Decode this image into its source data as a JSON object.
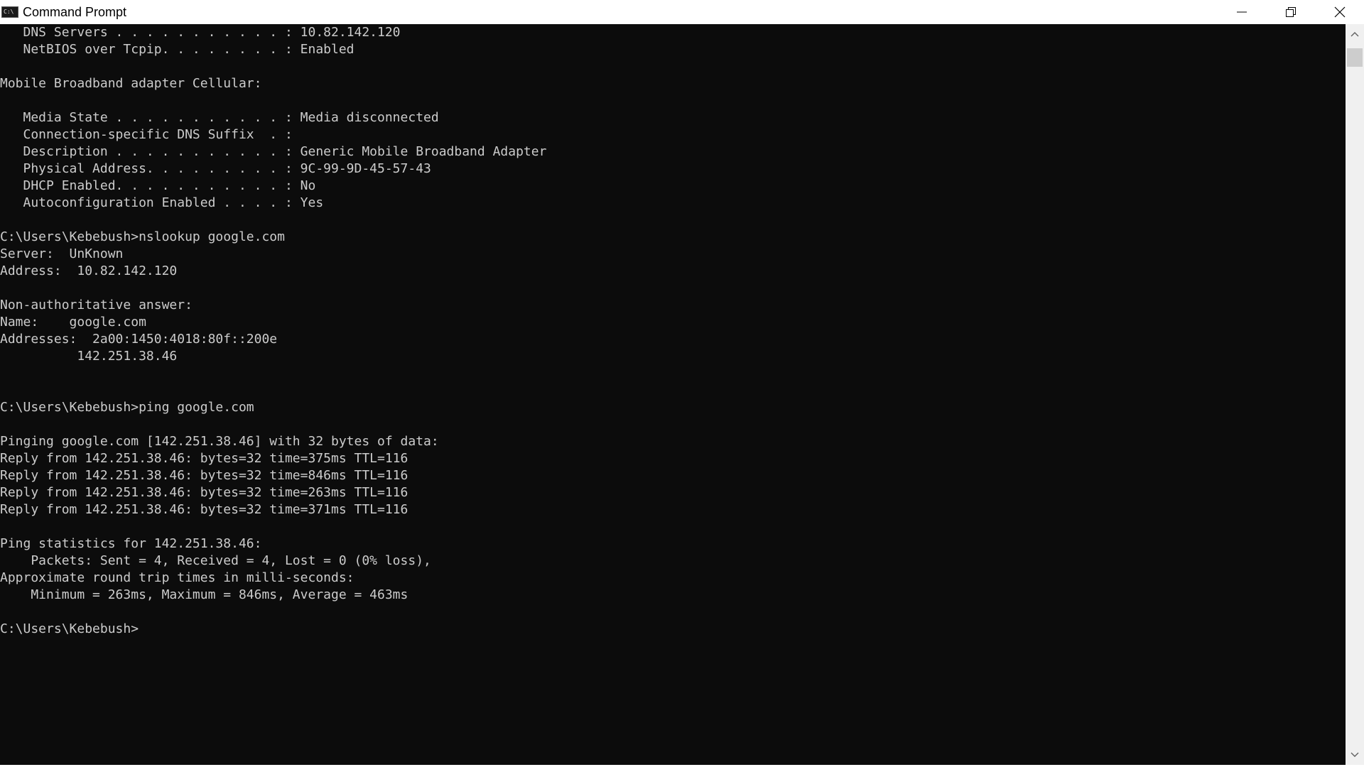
{
  "window": {
    "title": "Command Prompt",
    "icon": "console-app-icon",
    "icon_text": "C:\\"
  },
  "caption_buttons": {
    "minimize": "minimize-icon",
    "restore": "restore-icon",
    "close": "close-icon"
  },
  "console": {
    "lines": [
      "   DNS Servers . . . . . . . . . . . : 10.82.142.120",
      "   NetBIOS over Tcpip. . . . . . . . : Enabled",
      "",
      "Mobile Broadband adapter Cellular:",
      "",
      "   Media State . . . . . . . . . . . : Media disconnected",
      "   Connection-specific DNS Suffix  . :",
      "   Description . . . . . . . . . . . : Generic Mobile Broadband Adapter",
      "   Physical Address. . . . . . . . . : 9C-99-9D-45-57-43",
      "   DHCP Enabled. . . . . . . . . . . : No",
      "   Autoconfiguration Enabled . . . . : Yes",
      "",
      "C:\\Users\\Kebebush>nslookup google.com",
      "Server:  UnKnown",
      "Address:  10.82.142.120",
      "",
      "Non-authoritative answer:",
      "Name:    google.com",
      "Addresses:  2a00:1450:4018:80f::200e",
      "          142.251.38.46",
      "",
      "",
      "C:\\Users\\Kebebush>ping google.com",
      "",
      "Pinging google.com [142.251.38.46] with 32 bytes of data:",
      "Reply from 142.251.38.46: bytes=32 time=375ms TTL=116",
      "Reply from 142.251.38.46: bytes=32 time=846ms TTL=116",
      "Reply from 142.251.38.46: bytes=32 time=263ms TTL=116",
      "Reply from 142.251.38.46: bytes=32 time=371ms TTL=116",
      "",
      "Ping statistics for 142.251.38.46:",
      "    Packets: Sent = 4, Received = 4, Lost = 0 (0% loss),",
      "Approximate round trip times in milli-seconds:",
      "    Minimum = 263ms, Maximum = 846ms, Average = 463ms",
      "",
      "C:\\Users\\Kebebush>"
    ]
  },
  "scrollbar": {
    "up_icon": "scroll-up-arrow-icon",
    "down_icon": "scroll-down-arrow-icon"
  },
  "colors": {
    "console_background": "#0c0c0c",
    "console_text": "#cccccc",
    "titlebar_background": "#ffffff"
  }
}
